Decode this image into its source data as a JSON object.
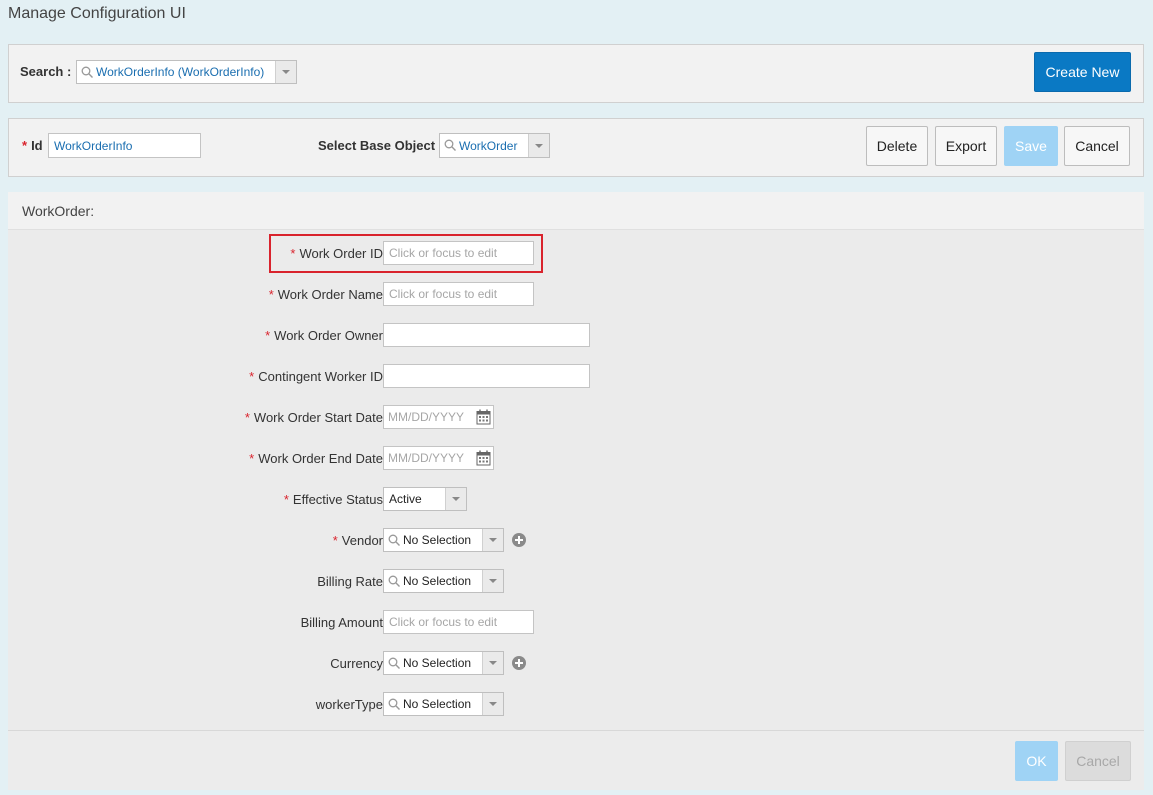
{
  "page_title": "Manage Configuration UI",
  "search": {
    "label": "Search :",
    "value": "WorkOrderInfo (WorkOrderInfo)",
    "create_new": "Create New"
  },
  "config": {
    "id_label": "Id",
    "id_value": "WorkOrderInfo",
    "base_label": "Select Base Object",
    "base_value": "WorkOrder",
    "delete": "Delete",
    "export": "Export",
    "save": "Save",
    "cancel": "Cancel"
  },
  "section": {
    "title": "WorkOrder:"
  },
  "fields": {
    "work_order_id": {
      "label": "Work Order ID",
      "placeholder": "Click or focus to edit"
    },
    "work_order_name": {
      "label": "Work Order Name",
      "placeholder": "Click or focus to edit"
    },
    "work_order_owner": {
      "label": "Work Order Owner"
    },
    "contingent_worker_id": {
      "label": "Contingent Worker ID"
    },
    "start_date": {
      "label": "Work Order Start Date",
      "placeholder": "MM/DD/YYYY"
    },
    "end_date": {
      "label": "Work Order End Date",
      "placeholder": "MM/DD/YYYY"
    },
    "effective_status": {
      "label": "Effective Status",
      "value": "Active"
    },
    "vendor": {
      "label": "Vendor",
      "value": "No Selection"
    },
    "billing_rate": {
      "label": "Billing Rate",
      "value": "No Selection"
    },
    "billing_amount": {
      "label": "Billing Amount",
      "placeholder": "Click or focus to edit"
    },
    "currency": {
      "label": "Currency",
      "value": "No Selection"
    },
    "worker_type": {
      "label": "workerType",
      "value": "No Selection"
    }
  },
  "footer": {
    "ok": "OK",
    "cancel": "Cancel"
  },
  "colors": {
    "required": "#d9232d",
    "primary": "#0a79c4",
    "link_blue": "#1a6eb0",
    "highlight": "#d9232d"
  },
  "icons": {
    "search": "search-icon",
    "calendar": "calendar-icon",
    "add": "plus-circle-icon",
    "dropdown": "chevron-down-icon"
  }
}
